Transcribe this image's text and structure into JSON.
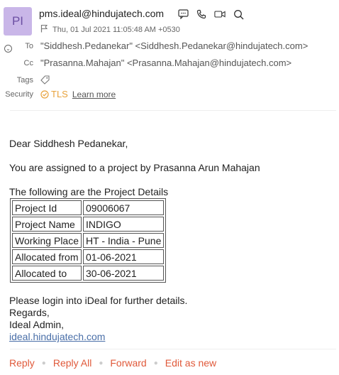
{
  "header": {
    "avatar_initials": "PI",
    "sender": "pms.ideal@hindujatech.com",
    "date": "Thu, 01 Jul 2021 11:05:48 AM +0530",
    "to_label": "To",
    "to_value": "\"Siddhesh.Pedanekar\" <Siddhesh.Pedanekar@hindujatech.com>",
    "cc_label": "Cc",
    "cc_value": "\"Prasanna.Mahajan\" <Prasanna.Mahajan@hindujatech.com>",
    "tags_label": "Tags",
    "security_label": "Security",
    "tls_label": "TLS",
    "learn_more": "Learn more"
  },
  "body": {
    "greeting": "Dear Siddhesh Pedanekar,",
    "assigned": "You are assigned to a project by Prasanna Arun Mahajan",
    "following": "The following are the Project Details",
    "details": [
      {
        "key": "Project Id",
        "value": "09006067"
      },
      {
        "key": "Project Name",
        "value": "INDIGO"
      },
      {
        "key": "Working Place",
        "value": "HT - India - Pune"
      },
      {
        "key": "Allocated from",
        "value": "01-06-2021"
      },
      {
        "key": "Allocated to",
        "value": "30-06-2021"
      }
    ],
    "login": "Please login into iDeal for further details.",
    "regards": "Regards,",
    "signature": "Ideal Admin,",
    "link": "ideal.hindujatech.com"
  },
  "actions": {
    "reply": "Reply",
    "reply_all": "Reply All",
    "forward": "Forward",
    "edit_as_new": "Edit as new"
  },
  "colors": {
    "avatar_bg": "#c9b6e8",
    "accent": "#e0593a",
    "tls": "#e8a23b",
    "link": "#4a6fa8"
  }
}
